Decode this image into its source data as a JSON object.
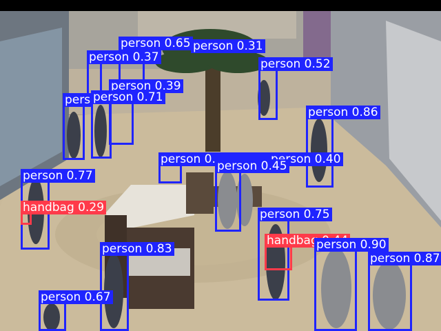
{
  "colors": {
    "person": "#1f24ff",
    "handbag": "#ff3a4a",
    "floor": "#c9b99a",
    "walls": "#8b8f95"
  },
  "detections": [
    {
      "label": "person 0.65"
    },
    {
      "label": "person 0.31"
    },
    {
      "label": "person 0.37"
    },
    {
      "label": "person 0.52"
    },
    {
      "label": "person 0.39"
    },
    {
      "label": "person 0.71"
    },
    {
      "label": "pers"
    },
    {
      "label": "person 0.86"
    },
    {
      "label": "person 0.40"
    },
    {
      "label": "person 0.45"
    },
    {
      "label": "person 0.77"
    },
    {
      "label": "handbag 0.29"
    },
    {
      "label": "person 0.75"
    },
    {
      "label": "handbag 0.44"
    },
    {
      "label": "person 0.83"
    },
    {
      "label": "person 0.90"
    },
    {
      "label": "person 0.87"
    },
    {
      "label": "person 0.67"
    }
  ]
}
